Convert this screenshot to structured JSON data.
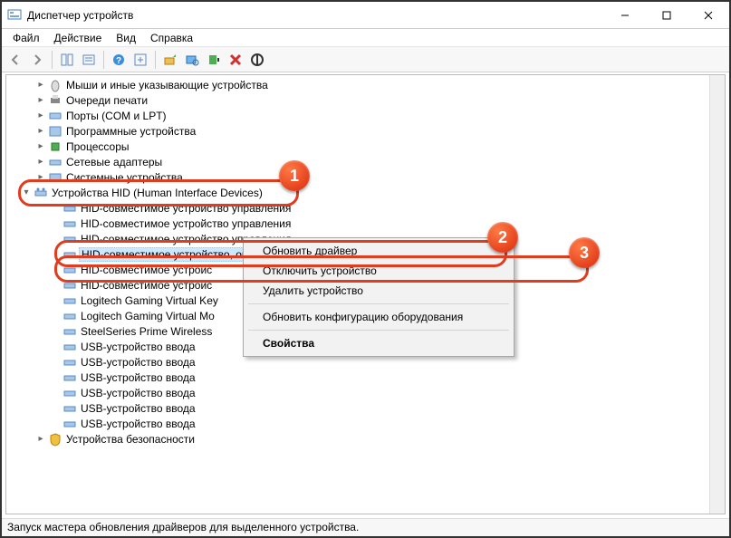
{
  "window": {
    "title": "Диспетчер устройств"
  },
  "menu": {
    "file": "Файл",
    "action": "Действие",
    "view": "Вид",
    "help": "Справка"
  },
  "categories": {
    "mice": "Мыши и иные указывающие устройства",
    "print_queues": "Очереди печати",
    "ports": "Порты (COM и LPT)",
    "software_devices": "Программные устройства",
    "processors": "Процессоры",
    "network": "Сетевые адаптеры",
    "system": "Системные устройства",
    "hid": "Устройства HID (Human Interface Devices)",
    "security": "Устройства безопасности"
  },
  "hid_items": {
    "compat_control_1": "HID-совместимое устройство управления",
    "compat_control_2": "HID-совместимое устройство управления",
    "compat_control_3": "HID-совместимое устройство управления",
    "vendor_defined": "HID-совместимое устройство, определенное поставщиком",
    "trunc_1": "HID-совместимое устройс",
    "trunc_2": "HID-совместимое устройс",
    "logitech_key": "Logitech Gaming Virtual Key",
    "logitech_mo": "Logitech Gaming Virtual Mo",
    "steelseries": "SteelSeries Prime Wireless",
    "usb_input_1": "USB-устройство ввода",
    "usb_input_2": "USB-устройство ввода",
    "usb_input_3": "USB-устройство ввода",
    "usb_input_4": "USB-устройство ввода",
    "usb_input_5": "USB-устройство ввода",
    "usb_input_6": "USB-устройство ввода"
  },
  "context_menu": {
    "update_driver": "Обновить драйвер",
    "disable_device": "Отключить устройство",
    "uninstall_device": "Удалить устройство",
    "scan_hardware": "Обновить конфигурацию оборудования",
    "properties": "Свойства"
  },
  "statusbar": {
    "text": "Запуск мастера обновления драйверов для выделенного устройства."
  },
  "callouts": {
    "n1": "1",
    "n2": "2",
    "n3": "3"
  }
}
